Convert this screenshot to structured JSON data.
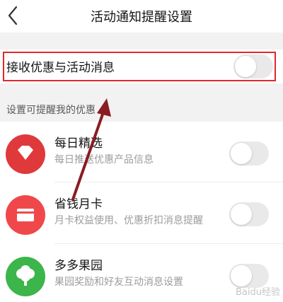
{
  "header": {
    "title": "活动通知提醒设置"
  },
  "top_option": {
    "label": "接收优惠与活动消息",
    "enabled": false
  },
  "section_title": "设置可提醒我的优惠",
  "items": [
    {
      "name": "每日精选",
      "desc": "每日推送优惠产品信息",
      "icon": "diamond-icon",
      "color": "#e0393b",
      "enabled": false
    },
    {
      "name": "省钱月卡",
      "desc": "月卡权益使用、优惠折扣消息提醒",
      "icon": "card-icon",
      "color": "#f0484a",
      "enabled": false
    },
    {
      "name": "多多果园",
      "desc": "果园奖励和好友互动消息设置",
      "icon": "tree-icon",
      "color": "#3cb54a",
      "enabled": false
    }
  ],
  "watermark": "Baidu经验"
}
